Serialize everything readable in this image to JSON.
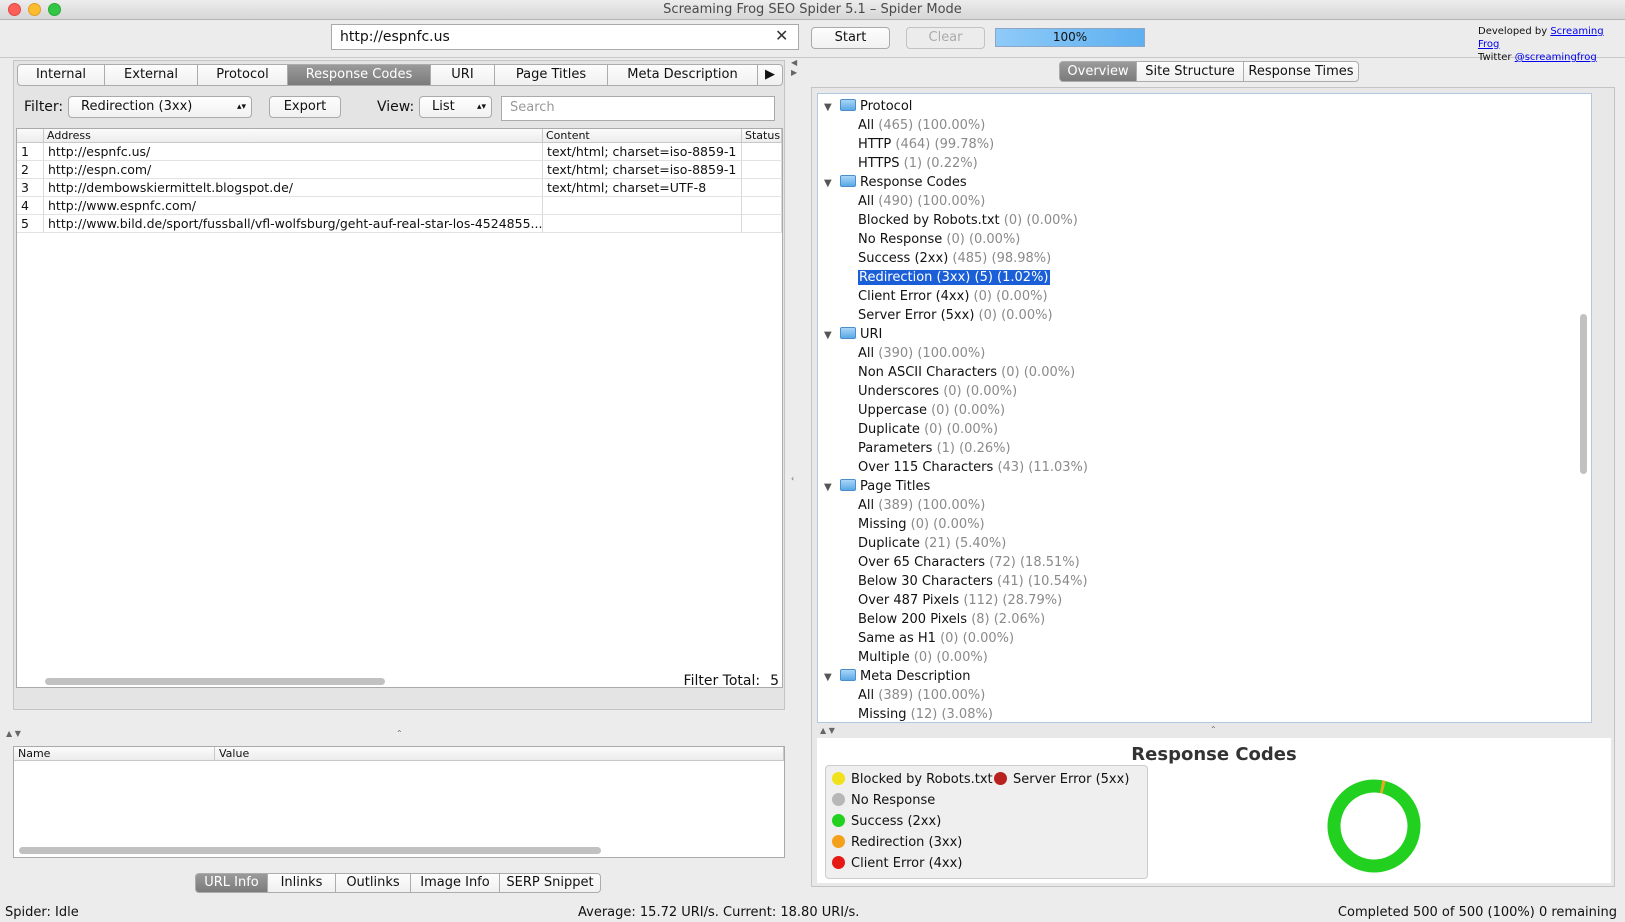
{
  "window": {
    "title": "Screaming Frog SEO Spider 5.1  –  Spider Mode"
  },
  "toolbar": {
    "url": "http://espnfc.us",
    "clear_icon": "✕",
    "start_label": "Start",
    "clear_label": "Clear",
    "progress_text": "100%",
    "progress_value": 1.0,
    "developed_by_label": "Developed by",
    "developed_by_link": "Screaming Frog",
    "twitter_label": "Twitter",
    "twitter_link": "@screamingfrog"
  },
  "left": {
    "tabs": [
      "Internal",
      "External",
      "Protocol",
      "Response Codes",
      "URI",
      "Page Titles",
      "Meta Description"
    ],
    "active_tab": "Response Codes",
    "more_icon": "▶",
    "filter_label": "Filter:",
    "filter_value": "Redirection (3xx)",
    "select_arrows": "▴▾",
    "export_label": "Export",
    "view_label": "View:",
    "view_value": "List",
    "search_placeholder": "Search",
    "columns": [
      "Address",
      "Content",
      "Status"
    ],
    "rows": [
      {
        "num": "1",
        "address": "http://espnfc.us/",
        "content": "text/html; charset=iso-8859-1",
        "status": ""
      },
      {
        "num": "2",
        "address": "http://espn.com/",
        "content": "text/html; charset=iso-8859-1",
        "status": ""
      },
      {
        "num": "3",
        "address": "http://dembowskiermittelt.blogspot.de/",
        "content": "text/html; charset=UTF-8",
        "status": ""
      },
      {
        "num": "4",
        "address": "http://www.espnfc.com/",
        "content": "",
        "status": ""
      },
      {
        "num": "5",
        "address": "http://www.bild.de/sport/fussball/vfl-wolfsburg/geht-auf-real-star-los-4524855...",
        "content": "",
        "status": ""
      }
    ],
    "filter_total_label": "Filter Total:",
    "filter_total_value": "5"
  },
  "info_panel": {
    "columns": [
      "Name",
      "Value"
    ],
    "tabs": [
      "URL Info",
      "Inlinks",
      "Outlinks",
      "Image Info",
      "SERP Snippet"
    ],
    "active_tab": "URL Info"
  },
  "right": {
    "tabs": [
      "Overview",
      "Site Structure",
      "Response Times"
    ],
    "active_tab": "Overview",
    "tree": [
      {
        "group": "Protocol",
        "items": [
          {
            "label": "All",
            "count": "(465) (100.00%)"
          },
          {
            "label": "HTTP",
            "count": "(464) (99.78%)"
          },
          {
            "label": "HTTPS",
            "count": "(1) (0.22%)"
          }
        ]
      },
      {
        "group": "Response Codes",
        "items": [
          {
            "label": "All",
            "count": "(490) (100.00%)"
          },
          {
            "label": "Blocked by Robots.txt",
            "count": "(0) (0.00%)"
          },
          {
            "label": "No Response",
            "count": "(0) (0.00%)"
          },
          {
            "label": "Success (2xx)",
            "count": "(485) (98.98%)"
          },
          {
            "label": "Redirection (3xx)",
            "count": "(5) (1.02%)",
            "selected": true
          },
          {
            "label": "Client Error (4xx)",
            "count": "(0) (0.00%)"
          },
          {
            "label": "Server Error (5xx)",
            "count": "(0) (0.00%)"
          }
        ]
      },
      {
        "group": "URI",
        "items": [
          {
            "label": "All",
            "count": "(390) (100.00%)"
          },
          {
            "label": "Non ASCII Characters",
            "count": "(0) (0.00%)"
          },
          {
            "label": "Underscores",
            "count": "(0) (0.00%)"
          },
          {
            "label": "Uppercase",
            "count": "(0) (0.00%)"
          },
          {
            "label": "Duplicate",
            "count": "(0) (0.00%)"
          },
          {
            "label": "Parameters",
            "count": "(1) (0.26%)"
          },
          {
            "label": "Over 115 Characters",
            "count": "(43) (11.03%)"
          }
        ]
      },
      {
        "group": "Page Titles",
        "items": [
          {
            "label": "All",
            "count": "(389) (100.00%)"
          },
          {
            "label": "Missing",
            "count": "(0) (0.00%)"
          },
          {
            "label": "Duplicate",
            "count": "(21) (5.40%)"
          },
          {
            "label": "Over 65 Characters",
            "count": "(72) (18.51%)"
          },
          {
            "label": "Below 30 Characters",
            "count": "(41) (10.54%)"
          },
          {
            "label": "Over 487 Pixels",
            "count": "(112) (28.79%)"
          },
          {
            "label": "Below 200 Pixels",
            "count": "(8) (2.06%)"
          },
          {
            "label": "Same as H1",
            "count": "(0) (0.00%)"
          },
          {
            "label": "Multiple",
            "count": "(0) (0.00%)"
          }
        ]
      },
      {
        "group": "Meta Description",
        "items": [
          {
            "label": "All",
            "count": "(389) (100.00%)"
          },
          {
            "label": "Missing",
            "count": "(12) (3.08%)"
          }
        ]
      }
    ],
    "tree_expand_icon": "▼",
    "chart": {
      "title": "Response Codes",
      "legend": [
        {
          "label": "Blocked by Robots.txt",
          "color": "#f1e11a"
        },
        {
          "label": "Server Error (5xx)",
          "color": "#b8211d"
        },
        {
          "label": "No Response",
          "color": "#b7b7b7"
        },
        {
          "label": "Success (2xx)",
          "color": "#22d01f"
        },
        {
          "label": "Redirection (3xx)",
          "color": "#f4a01b"
        },
        {
          "label": "Client Error (4xx)",
          "color": "#e51a14"
        }
      ]
    }
  },
  "chart_data": {
    "type": "pie",
    "title": "Response Codes",
    "categories": [
      "Blocked by Robots.txt",
      "No Response",
      "Success (2xx)",
      "Redirection (3xx)",
      "Client Error (4xx)",
      "Server Error (5xx)"
    ],
    "values": [
      0,
      0,
      485,
      5,
      0,
      0
    ],
    "colors": [
      "#f1e11a",
      "#b7b7b7",
      "#22d01f",
      "#f4a01b",
      "#e51a14",
      "#b8211d"
    ],
    "donut": true
  },
  "status": {
    "left": "Spider: Idle",
    "center": "Average: 15.72 URI/s. Current: 18.80 URI/s.",
    "right": "Completed 500 of 500 (100%) 0 remaining"
  }
}
